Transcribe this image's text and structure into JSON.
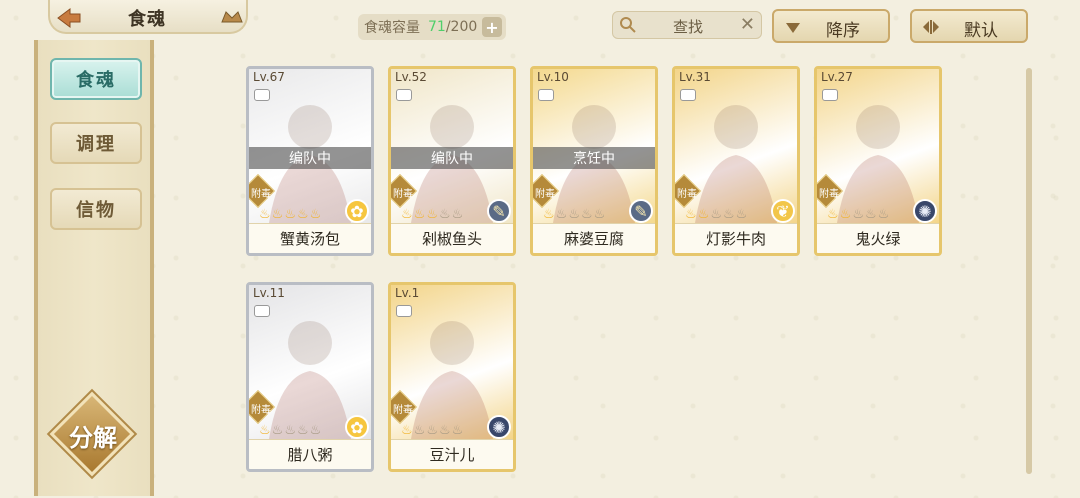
{
  "header": {
    "title": "食魂",
    "capacity_label": "食魂容量",
    "capacity_current": "71",
    "capacity_max": "/200",
    "search_label": "查找",
    "sort_label": "降序",
    "default_label": "默认"
  },
  "sidebar": {
    "tabs": [
      {
        "label": "食魂"
      },
      {
        "label": "调理"
      },
      {
        "label": "信物"
      }
    ],
    "decompose_label": "分解"
  },
  "cards": [
    {
      "level": "Lv.67",
      "status": "编队中",
      "tag": "附毒",
      "stars": 5,
      "lit": 5,
      "name": "蟹黄汤包",
      "emblem": "flower",
      "frame": "silver",
      "bg": "#e9e9ea"
    },
    {
      "level": "Lv.52",
      "status": "编队中",
      "tag": "附毒",
      "stars": 5,
      "lit": 3,
      "name": "剁椒鱼头",
      "emblem": "quill",
      "frame": "gold",
      "bg": "#f0e6c8"
    },
    {
      "level": "Lv.10",
      "status": "烹饪中",
      "tag": "附毒",
      "stars": 5,
      "lit": 1,
      "name": "麻婆豆腐",
      "emblem": "quill",
      "frame": "gold",
      "bg": "#f4d98e"
    },
    {
      "level": "Lv.31",
      "status": "",
      "tag": "附毒",
      "stars": 5,
      "lit": 2,
      "name": "灯影牛肉",
      "emblem": "leaf",
      "frame": "gold",
      "bg": "#f3d58a"
    },
    {
      "level": "Lv.27",
      "status": "",
      "tag": "附毒",
      "stars": 5,
      "lit": 2,
      "name": "鬼火绿",
      "emblem": "gear",
      "frame": "gold",
      "bg": "#f3d58a"
    },
    {
      "level": "Lv.11",
      "status": "",
      "tag": "附毒",
      "stars": 5,
      "lit": 1,
      "name": "腊八粥",
      "emblem": "flower",
      "frame": "silver",
      "bg": "#e4e4e6"
    },
    {
      "level": "Lv.1",
      "status": "",
      "tag": "附毒",
      "stars": 5,
      "lit": 1,
      "name": "豆汁儿",
      "emblem": "gear",
      "frame": "gold",
      "bg": "#f3d58a"
    }
  ]
}
